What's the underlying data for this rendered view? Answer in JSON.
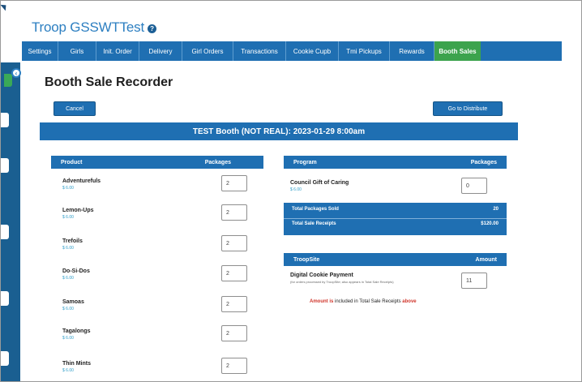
{
  "header": {
    "troop_title": "Troop GSSWTTest",
    "info_icon": "?"
  },
  "nav": {
    "items": [
      {
        "label": "Settings",
        "active": false
      },
      {
        "label": "Girls",
        "active": false
      },
      {
        "label": "Init. Order",
        "active": false
      },
      {
        "label": "Delivery",
        "active": false
      },
      {
        "label": "Girl Orders",
        "active": false
      },
      {
        "label": "Transactions",
        "active": false
      },
      {
        "label": "Cookie Cupb",
        "active": false
      },
      {
        "label": "Tmi Pickups",
        "active": false
      },
      {
        "label": "Rewards",
        "active": false
      },
      {
        "label": "Booth Sales",
        "active": true
      }
    ]
  },
  "page": {
    "title": "Booth Sale Recorder",
    "cancel_label": "Cancel",
    "distribute_label": "Go to Distribute",
    "booth_banner": "TEST Booth (NOT REAL): 2023-01-29 8:00am"
  },
  "products": {
    "head_product": "Product",
    "head_packages": "Packages",
    "rows": [
      {
        "name": "Adventurefuls",
        "price": "$ 6.00",
        "qty": "2"
      },
      {
        "name": "Lemon-Ups",
        "price": "$ 6.00",
        "qty": "2"
      },
      {
        "name": "Trefoils",
        "price": "$ 6.00",
        "qty": "2"
      },
      {
        "name": "Do-Si-Dos",
        "price": "$ 6.00",
        "qty": "2"
      },
      {
        "name": "Samoas",
        "price": "$ 6.00",
        "qty": "2"
      },
      {
        "name": "Tagalongs",
        "price": "$ 6.00",
        "qty": "2"
      },
      {
        "name": "Thin Mints",
        "price": "$ 6.00",
        "qty": "2"
      }
    ]
  },
  "program": {
    "head_program": "Program",
    "head_packages": "Packages",
    "row": {
      "name": "Council Gift of Caring",
      "price": "$ 6.00",
      "qty": "0"
    },
    "total_packages_label": "Total Packages Sold",
    "total_packages_value": "20",
    "total_receipts_label": "Total Sale Receipts",
    "total_receipts_value": "$120.00"
  },
  "troopsite": {
    "head_label": "TroopSite",
    "head_amount": "Amount",
    "digital_label": "Digital Cookie Payment",
    "digital_note": "(for orders processed by TroopSite; also appears in Total Sale Receipts)",
    "digital_value": "11",
    "note_a": "Amount is",
    "note_b": "included in Total Sale Receipts",
    "note_c": "above"
  }
}
